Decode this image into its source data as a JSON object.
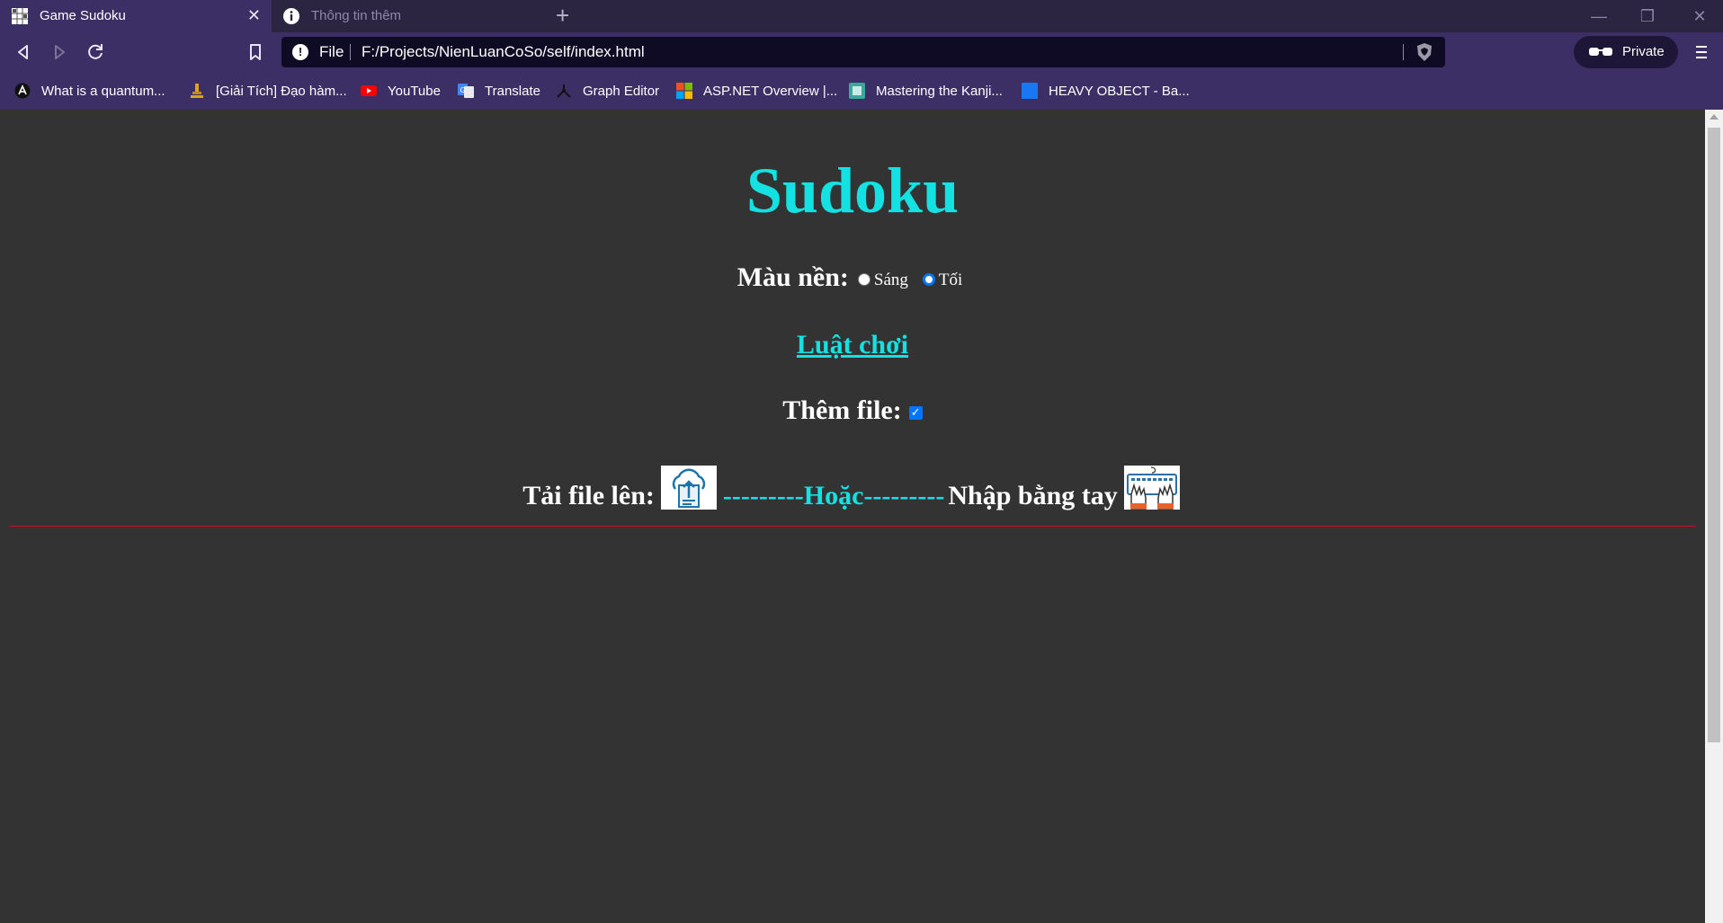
{
  "browser": {
    "tabs": [
      {
        "title": "Game Sudoku",
        "active": true,
        "close_label": "✕"
      },
      {
        "title": "Thông tin thêm",
        "active": false
      }
    ],
    "new_tab_label": "+",
    "window_controls": {
      "minimize": "—",
      "restore": "❐",
      "close": "✕"
    },
    "url": {
      "scheme": "File",
      "path": "F:/Projects/NienLuanCoSo/self/index.html"
    },
    "private_label": "Private",
    "bookmarks": [
      {
        "label": "What is a quantum...",
        "icon": "quantum-site-icon"
      },
      {
        "label": "[Giải Tích] Đạo hàm...",
        "icon": "microscope-icon"
      },
      {
        "label": "YouTube",
        "icon": "youtube-icon"
      },
      {
        "label": "Translate",
        "icon": "translate-icon"
      },
      {
        "label": "Graph Editor",
        "icon": "graph-editor-icon"
      },
      {
        "label": "ASP.NET Overview |...",
        "icon": "microsoft-icon"
      },
      {
        "label": "Mastering the Kanji...",
        "icon": "kanji-site-icon"
      },
      {
        "label": "HEAVY OBJECT - Ba...",
        "icon": "blue-square-icon"
      }
    ]
  },
  "page": {
    "title": "Sudoku",
    "background_label": "Màu nền:",
    "theme_options": [
      {
        "label": "Sáng",
        "checked": false
      },
      {
        "label": "Tối",
        "checked": true
      }
    ],
    "rules_link": "Luật chơi",
    "add_file_label": "Thêm file:",
    "add_file_checked": true,
    "upload_label": "Tải file lên:",
    "or_separator": "---------Hoặc---------",
    "manual_entry_label": "Nhập bằng tay"
  },
  "colors": {
    "accent": "#14e1e1",
    "page_background": "#333333",
    "chrome": "#3b2f66",
    "divider": "#c8102e"
  }
}
